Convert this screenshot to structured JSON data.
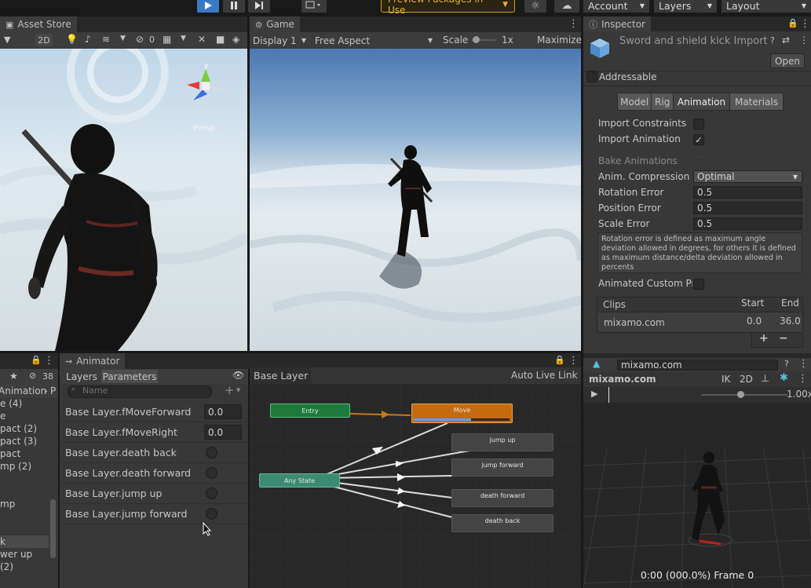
{
  "toolbar": {
    "preview_packages": "Preview Packages in Use",
    "account": "Account",
    "layers": "Layers",
    "layout": "Layout"
  },
  "scene_tab": {
    "title": "Asset Store",
    "mode_2d": "2D",
    "hidden_count": "0",
    "persp_label": "Persp"
  },
  "game_tab": {
    "title": "Game",
    "display": "Display 1",
    "aspect": "Free Aspect",
    "scale_label": "Scale",
    "scale_value": "1x",
    "maximize": "Maximize"
  },
  "inspector": {
    "tab_title": "Inspector",
    "asset_title": "Sword and shield kick Import",
    "open_button": "Open",
    "addressable": "Addressable",
    "tabs": [
      "Model",
      "Rig",
      "Animation",
      "Materials"
    ],
    "import_constraints": "Import Constraints",
    "import_animation": "Import Animation",
    "bake_animations": "Bake Animations",
    "anim_compression_label": "Anim. Compression",
    "anim_compression_value": "Optimal",
    "rotation_error_label": "Rotation Error",
    "rotation_error_value": "0.5",
    "position_error_label": "Position Error",
    "position_error_value": "0.5",
    "scale_error_label": "Scale Error",
    "scale_error_value": "0.5",
    "help_text": "Rotation error is defined as maximum angle deviation allowed in degrees, for others it is defined as maximum distance/delta deviation allowed in percents",
    "animated_custom": "Animated Custom Prc",
    "clips_header": "Clips",
    "start_header": "Start",
    "end_header": "End",
    "clip_name": "mixamo.com",
    "clip_start": "0.0",
    "clip_end": "36.0",
    "add_icon": "+",
    "remove_icon": "−"
  },
  "project_panel": {
    "count": "38",
    "breadcrumb": "Animation",
    "breadcrumb_tail": "P",
    "items": [
      "e (4)",
      "e",
      "pact (2)",
      "pact (3)",
      "pact",
      "mp (2)",
      "",
      "mp",
      "",
      "",
      "k",
      "wer up",
      " (2)"
    ]
  },
  "animator": {
    "tab_title": "Animator",
    "layers_tab": "Layers",
    "parameters_tab": "Parameters",
    "search_placeholder": "Name",
    "breadcrumb": "Base Layer",
    "auto_live_link": "Auto Live Link",
    "parameters": [
      {
        "name": "Base Layer.fMoveForward",
        "value": "0.0"
      },
      {
        "name": "Base Layer.fMoveRight",
        "value": "0.0"
      },
      {
        "name": "Base Layer.death back",
        "value": ""
      },
      {
        "name": "Base Layer.death forward",
        "value": ""
      },
      {
        "name": "Base Layer.jump up",
        "value": ""
      },
      {
        "name": "Base Layer.jump forward",
        "value": ""
      }
    ],
    "nodes": {
      "entry": "Entry",
      "move": "Move",
      "any_state": "Any State",
      "jump_up": "jump up",
      "jump_forward": "jump forward",
      "death_forward": "death forward",
      "death_back": "death back"
    },
    "move_progress": 0.6
  },
  "preview": {
    "clip_field": "mixamo.com",
    "title": "mixamo.com",
    "ik": "IK",
    "mode_2d": "2D",
    "speed": "1.00x",
    "status": "0:00 (000.0%) Frame 0"
  },
  "colors": {
    "entry_node": "#1e7a3c",
    "move_node": "#c66a10",
    "any_state_node": "#3b8a72",
    "state_node": "#444444",
    "accent_blue": "#3a79c6"
  }
}
